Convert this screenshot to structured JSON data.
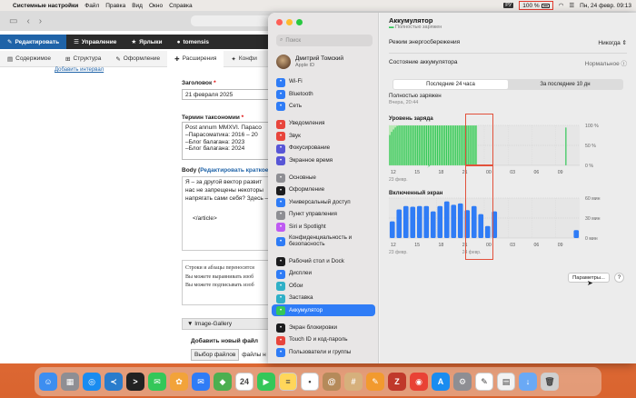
{
  "menubar": {
    "app": "Системные настройки",
    "menus": [
      "Файл",
      "Правка",
      "Вид",
      "Окно",
      "Справка"
    ],
    "lang": "РУ",
    "battery": "100 %",
    "datetime": "Пн, 24 февр.  09:13"
  },
  "browser": {
    "toolbar_dark": [
      "Редактировать",
      "Управление",
      "Ярлыки",
      "tomensis"
    ],
    "toolbar_light": [
      "Содержимое",
      "Структура",
      "Оформление",
      "Расширения",
      "Конфи"
    ],
    "add_link": "Добавить интервал",
    "title_label": "Заголовок",
    "title_value": "21 февраля 2025",
    "taxonomy_label": "Термин таксономии",
    "taxonomy_lines": [
      "Post annum MMXVI. Парасо",
      "–Парасоматика: 2016 – 20",
      "–Блог балагана: 2023",
      "–Блог балагана: 2024"
    ],
    "body_label": "Body",
    "body_link": "Редактировать краткое",
    "body_lines": [
      "Я – за другой вектор развит",
      "нас не запрещены некоторы",
      "напрягать сами себя? Здесь –"
    ],
    "body_tag": "</article>",
    "hint_lines": [
      "Строки и абзацы переносятся",
      "Вы можете выравнивать изоб",
      "Вы можете подписывать изоб"
    ],
    "gallery": "Image-Gallery",
    "add_file": "Добавить новый файл",
    "choose_files": "Выбор файлов",
    "files_hint": "файлы н"
  },
  "settings": {
    "search_placeholder": "Поиск",
    "user_name": "Дмитрий Томский",
    "user_sub": "Apple ID",
    "sidebar": [
      {
        "label": "Wi-Fi",
        "icon": "wifi-icon",
        "color": "#2f7cf6"
      },
      {
        "label": "Bluetooth",
        "icon": "bluetooth-icon",
        "color": "#2f7cf6"
      },
      {
        "label": "Сеть",
        "icon": "network-icon",
        "color": "#2f7cf6"
      },
      {
        "label": "Уведомления",
        "icon": "notifications-icon",
        "color": "#e8453c"
      },
      {
        "label": "Звук",
        "icon": "sound-icon",
        "color": "#e8453c"
      },
      {
        "label": "Фокусирование",
        "icon": "focus-icon",
        "color": "#5856d6"
      },
      {
        "label": "Экранное время",
        "icon": "screen-time-icon",
        "color": "#5856d6"
      },
      {
        "label": "Основные",
        "icon": "general-icon",
        "color": "#8e8e93"
      },
      {
        "label": "Оформление",
        "icon": "appearance-icon",
        "color": "#1c1c1e"
      },
      {
        "label": "Универсальный доступ",
        "icon": "accessibility-icon",
        "color": "#2f7cf6"
      },
      {
        "label": "Пункт управления",
        "icon": "control-center-icon",
        "color": "#8e8e93"
      },
      {
        "label": "Siri и Spotlight",
        "icon": "siri-icon",
        "color": "#bf5af2"
      },
      {
        "label": "Конфиденциальность и безопасность",
        "icon": "privacy-icon",
        "color": "#2f7cf6"
      },
      {
        "label": "Рабочий стол и Dock",
        "icon": "desktop-dock-icon",
        "color": "#1c1c1e"
      },
      {
        "label": "Дисплеи",
        "icon": "displays-icon",
        "color": "#2f7cf6"
      },
      {
        "label": "Обои",
        "icon": "wallpaper-icon",
        "color": "#30b0c7"
      },
      {
        "label": "Заставка",
        "icon": "screensaver-icon",
        "color": "#30b0c7"
      },
      {
        "label": "Аккумулятор",
        "icon": "battery-icon",
        "color": "#34c759"
      },
      {
        "label": "Экран блокировки",
        "icon": "lock-screen-icon",
        "color": "#1c1c1e"
      },
      {
        "label": "Touch ID и код-пароль",
        "icon": "touch-id-icon",
        "color": "#e8453c"
      },
      {
        "label": "Пользователи и группы",
        "icon": "users-icon",
        "color": "#2f7cf6"
      }
    ],
    "title": "Аккумулятор",
    "subtitle": "Полностью заряжен",
    "energy_mode_label": "Режим энергосбережения",
    "energy_mode_value": "Никогда",
    "health_label": "Состояние аккумулятора",
    "health_value": "Нормальное",
    "tabs": [
      "Последние 24 часа",
      "За последние 10 дн"
    ],
    "status_title": "Полностью заряжен",
    "status_time": "Вчера, 20:44",
    "params_button": "Параметры...",
    "help_button": "?"
  },
  "chart_data": [
    {
      "type": "bar",
      "title": "Уровень заряда",
      "y_ticks": [
        "100 %",
        "50 %",
        "0 %"
      ],
      "ylim": [
        0,
        100
      ],
      "x_ticks": [
        "12",
        "15",
        "18",
        "21",
        "00",
        "03",
        "06",
        "09"
      ],
      "x_note": "23 февр.",
      "values": [
        76,
        84,
        90,
        95,
        99,
        100,
        100,
        100,
        100,
        100,
        100,
        100,
        100,
        100,
        100,
        100,
        100,
        100,
        100,
        100,
        100,
        100,
        100,
        100,
        100,
        100,
        100,
        100,
        100,
        100,
        100,
        100,
        100,
        100,
        100,
        100,
        100,
        100,
        100,
        100,
        100,
        100,
        100,
        100,
        100,
        100,
        100,
        100,
        0,
        0,
        0,
        0,
        0,
        0,
        0,
        0,
        0,
        0,
        0,
        0,
        0,
        0,
        0,
        0,
        0,
        0,
        0,
        0,
        0,
        0,
        0,
        0,
        0,
        0,
        0,
        0,
        0,
        0,
        0,
        0,
        0,
        0,
        0,
        0,
        0,
        0,
        0,
        0,
        0,
        0,
        0,
        0,
        0,
        0,
        0,
        0,
        95,
        0,
        0,
        0,
        0,
        0,
        0,
        0
      ],
      "series_color": "#34c759",
      "charging_color": "#b9e8b6"
    },
    {
      "type": "bar",
      "title": "Включенный экран",
      "y_ticks": [
        "60 мин",
        "30 мин",
        "0 мин"
      ],
      "ylim": [
        0,
        60
      ],
      "x_ticks": [
        "12",
        "15",
        "18",
        "21",
        "00",
        "03",
        "06",
        "09"
      ],
      "x_note_left": "23 февр.",
      "x_note_right": "24 февр.",
      "values": [
        25,
        43,
        48,
        47,
        48,
        48,
        40,
        48,
        55,
        50,
        52,
        42,
        48,
        36,
        18,
        40,
        0,
        0,
        0,
        0,
        0,
        0,
        0,
        0,
        0,
        0,
        0,
        12
      ],
      "series_color": "#2f7cf6"
    }
  ],
  "dock": [
    {
      "name": "finder-icon",
      "color": "#3d8ef0",
      "glyph": "☺"
    },
    {
      "name": "launchpad-icon",
      "color": "#8e8e93",
      "glyph": "▦"
    },
    {
      "name": "safari-icon",
      "color": "#1a8cf0",
      "glyph": "◎"
    },
    {
      "name": "vscode-icon",
      "color": "#2a7ccc",
      "glyph": "≺"
    },
    {
      "name": "terminal-icon",
      "color": "#222222",
      "glyph": ">"
    },
    {
      "name": "messages-icon",
      "color": "#34c759",
      "glyph": "✉"
    },
    {
      "name": "photos-icon",
      "color": "#f2a33a",
      "glyph": "✿"
    },
    {
      "name": "mail-icon",
      "color": "#2f7cf6",
      "glyph": "✉"
    },
    {
      "name": "maps-icon",
      "color": "#4caf50",
      "glyph": "◆"
    },
    {
      "name": "calendar-icon",
      "color": "#ffffff",
      "glyph": "24"
    },
    {
      "name": "facetime-icon",
      "color": "#34c759",
      "glyph": "▶"
    },
    {
      "name": "notes-icon",
      "color": "#ffd65a",
      "glyph": "≡"
    },
    {
      "name": "reminders-icon",
      "color": "#ffffff",
      "glyph": "•"
    },
    {
      "name": "contacts-icon",
      "color": "#b58a5a",
      "glyph": "@"
    },
    {
      "name": "numbers-icon",
      "color": "#d6b07c",
      "glyph": "#"
    },
    {
      "name": "pages-icon",
      "color": "#f29a2e",
      "glyph": "✎"
    },
    {
      "name": "filezilla-icon",
      "color": "#c0392b",
      "glyph": "Z"
    },
    {
      "name": "chrome-icon",
      "color": "#e94235",
      "glyph": "◉"
    },
    {
      "name": "app-store-icon",
      "color": "#1a8cf0",
      "glyph": "A"
    },
    {
      "name": "system-settings-icon",
      "color": "#8e8e93",
      "glyph": "⚙"
    },
    {
      "name": "textedit-icon",
      "color": "#ffffff",
      "glyph": "✎"
    },
    {
      "name": "preview-icon",
      "color": "#f2f2f2",
      "glyph": "▤"
    },
    {
      "name": "downloads-icon",
      "color": "#6aa9f5",
      "glyph": "↓"
    },
    {
      "name": "trash-icon",
      "color": "#d0d0d0",
      "glyph": "🗑"
    }
  ]
}
